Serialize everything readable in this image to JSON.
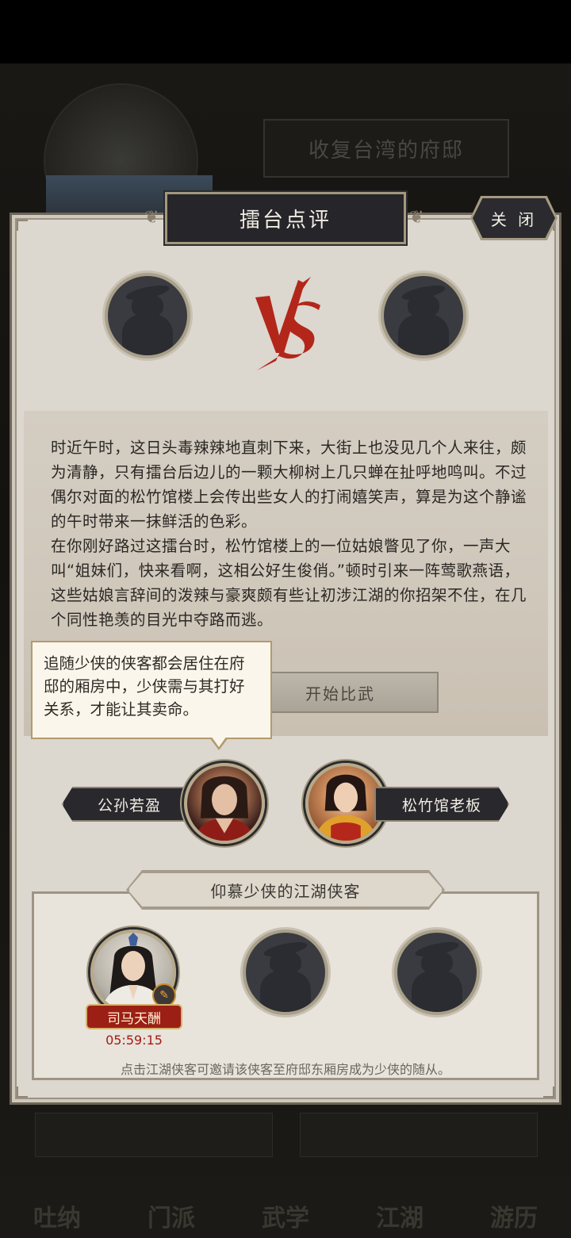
{
  "background": {
    "title": "收复台湾的府邸",
    "nav": [
      "吐纳",
      "门派",
      "武学",
      "江湖",
      "游历"
    ]
  },
  "dialog": {
    "title": "擂台点评",
    "close_label": "关 闭",
    "story_paragraphs": [
      "时近午时，这日头毒辣辣地直刺下来，大街上也没见几个人来往，颇为清静，只有擂台后边儿的一颗大柳树上几只蝉在扯呼地鸣叫。不过偶尔对面的松竹馆楼上会传出些女人的打闹嬉笑声，算是为这个静谧的午时带来一抹鲜活的色彩。",
      "在你刚好路过这擂台时，松竹馆楼上的一位姑娘瞥见了你，一声大叫“姐妹们，快来看啊，这相公好生俊俏。”顿时引来一阵莺歌燕语，这些姑娘言辞间的泼辣与豪爽颇有些让初涉江湖的你招架不住，在几个同性艳羡的目光中夺路而逃。"
    ],
    "start_button": "开始比武",
    "tooltip": "追随少侠的侠客都会居住在府邸的厢房中，少侠需与其打好关系，才能让其卖命。",
    "left_fighter": "公孙若盈",
    "right_fighter": "松竹馆老板",
    "section_title": "仰慕少侠的江湖侠客",
    "admirers": [
      {
        "name": "司马天酬",
        "timer": "05:59:15",
        "badge": "✎"
      }
    ],
    "hint": "点击江湖侠客可邀请该侠客至府邸东厢房成为少侠的随从。"
  },
  "colors": {
    "panel_bg": "#dcd7cf",
    "plate_dark": "#28282d",
    "accent_red": "#a21d13",
    "vs_red": "#b3261a"
  }
}
